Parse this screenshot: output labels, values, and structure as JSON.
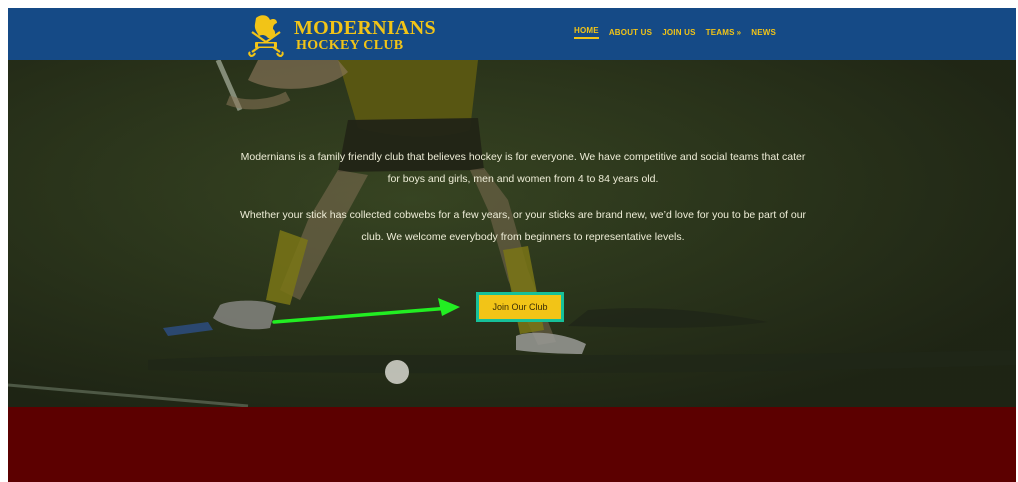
{
  "brand": {
    "name_line1": "MODERNIANS",
    "name_line2": "HOCKEY CLUB"
  },
  "nav": {
    "items": [
      {
        "label": "HOME",
        "active": true
      },
      {
        "label": "ABOUT US",
        "active": false
      },
      {
        "label": "JOIN US",
        "active": false
      },
      {
        "label": "TEAMS",
        "active": false,
        "has_dropdown": true
      },
      {
        "label": "NEWS",
        "active": false
      }
    ],
    "dropdown_icon": "chevron-down-icon"
  },
  "hero": {
    "paragraph1": "Modernians is a family friendly club that believes hockey is for everyone. We have competitive and social teams that cater for boys and girls, men and women from 4 to 84 years old.",
    "paragraph2": "Whether your stick has collected cobwebs for a few years, or your sticks are brand new, we’d love for you to be part of our club. We welcome everybody from beginners to representative levels.",
    "cta_label": "Join Our Club"
  },
  "colors": {
    "header_bg": "#154a86",
    "accent_gold": "#f2c417",
    "button_border": "#16c09a",
    "annotation_arrow": "#22ee22",
    "footer_band": "#5c0000"
  }
}
